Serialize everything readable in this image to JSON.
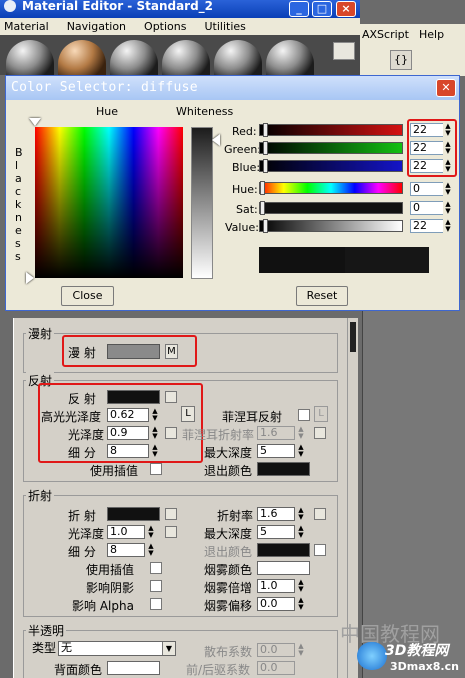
{
  "app": {
    "title": "Material Editor - Standard_2"
  },
  "menu": [
    "Material",
    "Navigation",
    "Options",
    "Utilities"
  ],
  "right_menu": [
    "AXScript",
    "Help"
  ],
  "dialog": {
    "title": "Color Selector: diffuse",
    "hue_label": "Hue",
    "whiteness_label": "Whiteness",
    "blackness_label": "B l a c k n e s s",
    "rows": [
      {
        "label": "Red:",
        "value": "22"
      },
      {
        "label": "Green:",
        "value": "22"
      },
      {
        "label": "Blue:",
        "value": "22"
      },
      {
        "label": "Hue:",
        "value": "0"
      },
      {
        "label": "Sat:",
        "value": "0"
      },
      {
        "label": "Value:",
        "value": "22"
      }
    ],
    "close_label": "Close",
    "reset_label": "Reset",
    "colors": {
      "red": "#d41212",
      "green": "#12c012",
      "blue": "#1414c8",
      "swatch": "#161616"
    }
  },
  "panel": {
    "diffuse_group": "漫射",
    "diffuse_label": "漫 射",
    "map_button": "M",
    "reflect_group": "反射",
    "reflect_label": "反 射",
    "gloss_label": "高光光泽度",
    "gloss_value": "0.62",
    "lock_button": "L",
    "glossiness_label": "光泽度",
    "glossiness_value": "0.9",
    "subdiv_label": "细 分",
    "subdiv_value": "8",
    "fresnel_label": "菲涅耳反射",
    "fresnel_lock": "L",
    "fresnel_ior_label": "菲涅耳折射率",
    "fresnel_ior_value": "1.6",
    "max_depth_label": "最大深度",
    "max_depth_value": "5",
    "use_interp_label": "使用插值",
    "exit_color_label": "退出颜色",
    "refract_group": "折射",
    "refract_label": "折 射",
    "r_gloss_label": "光泽度",
    "r_gloss_value": "1.0",
    "ior_label": "折射率",
    "ior_value": "1.6",
    "r_max_depth_label": "最大深度",
    "r_max_depth_value": "5",
    "r_subdiv_label": "细 分",
    "r_subdiv_value": "8",
    "r_exit_color_label": "退出颜色",
    "r_use_interp_label": "使用插值",
    "fog_color_label": "烟雾颜色",
    "affect_shadow_label": "影响阴影",
    "fog_mult_label": "烟雾倍增",
    "fog_mult_value": "1.0",
    "affect_alpha_label": "影响 Alpha",
    "fog_bias_label": "烟雾偏移",
    "fog_bias_value": "0.0",
    "translucent_group": "半透明",
    "type_label": "类型",
    "type_value": "无",
    "scatter_label": "散布系数",
    "scatter_value": "0.0",
    "back_color_label": "背面颜色",
    "fb_label": "前/后驱系数",
    "fb_value": "0.0"
  },
  "watermark": {
    "text1": "中国教程网",
    "text2": "3D教程网",
    "text3": "3Dmax8.cn"
  }
}
